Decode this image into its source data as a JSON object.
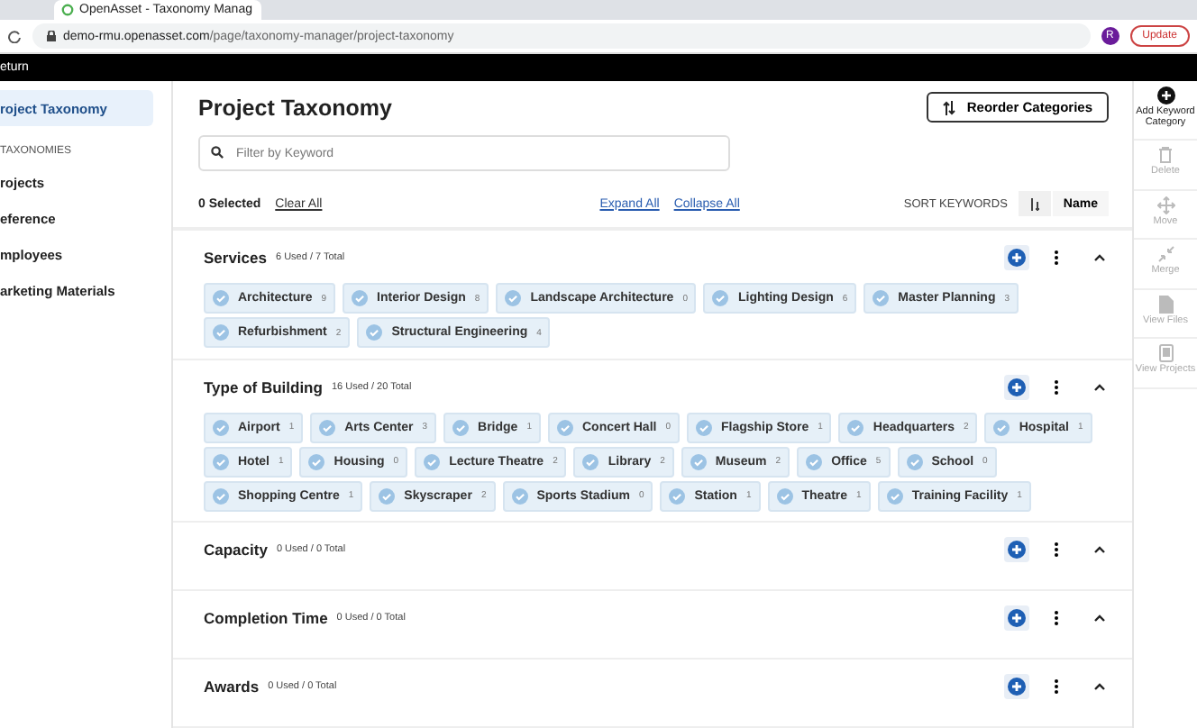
{
  "browser": {
    "tab_title": "OpenAsset - Taxonomy Manag",
    "url_host": "demo-rmu.openasset.com",
    "url_path": "/page/taxonomy-manager/project-taxonomy",
    "avatar": "R",
    "update": "Update"
  },
  "topbar": {
    "label": "eturn"
  },
  "sidebar": {
    "items": [
      {
        "label": "roject Taxonomy",
        "selected": true
      }
    ],
    "section": "TAXONOMIES",
    "links": [
      {
        "label": "rojects",
        "selected": false
      },
      {
        "label": "eference",
        "selected": false
      },
      {
        "label": "mployees",
        "selected": false
      },
      {
        "label": "arketing Materials",
        "selected": false
      }
    ]
  },
  "header": {
    "title": "Project Taxonomy",
    "reorder": "Reorder Categories",
    "search": {
      "placeholder": "Filter by Keyword"
    },
    "selected": "0 Selected",
    "clear": "Clear All",
    "expand": "Expand All",
    "collapse": "Collapse All",
    "sort_label": "SORT KEYWORDS",
    "sort_by": "Name"
  },
  "categories": [
    {
      "name": "Services",
      "summary": "6 Used / 7 Total",
      "expanded": true,
      "keywords": [
        {
          "label": "Architecture",
          "count": "9"
        },
        {
          "label": "Interior Design",
          "count": "8"
        },
        {
          "label": "Landscape Architecture",
          "count": "0"
        },
        {
          "label": "Lighting Design",
          "count": "6"
        },
        {
          "label": "Master Planning",
          "count": "3"
        },
        {
          "label": "Refurbishment",
          "count": "2"
        },
        {
          "label": "Structural Engineering",
          "count": "4"
        }
      ]
    },
    {
      "name": "Type of Building",
      "summary": "16 Used / 20 Total",
      "expanded": true,
      "keywords": [
        {
          "label": "Airport",
          "count": "1"
        },
        {
          "label": "Arts Center",
          "count": "3"
        },
        {
          "label": "Bridge",
          "count": "1"
        },
        {
          "label": "Concert Hall",
          "count": "0"
        },
        {
          "label": "Flagship Store",
          "count": "1"
        },
        {
          "label": "Headquarters",
          "count": "2"
        },
        {
          "label": "Hospital",
          "count": "1"
        },
        {
          "label": "Hotel",
          "count": "1"
        },
        {
          "label": "Housing",
          "count": "0"
        },
        {
          "label": "Lecture Theatre",
          "count": "2"
        },
        {
          "label": "Library",
          "count": "2"
        },
        {
          "label": "Museum",
          "count": "2"
        },
        {
          "label": "Office",
          "count": "5"
        },
        {
          "label": "School",
          "count": "0"
        },
        {
          "label": "Shopping Centre",
          "count": "1"
        },
        {
          "label": "Skyscraper",
          "count": "2"
        },
        {
          "label": "Sports Stadium",
          "count": "0"
        },
        {
          "label": "Station",
          "count": "1"
        },
        {
          "label": "Theatre",
          "count": "1"
        },
        {
          "label": "Training Facility",
          "count": "1"
        }
      ]
    },
    {
      "name": "Capacity",
      "summary": "0 Used / 0 Total",
      "expanded": true
    },
    {
      "name": "Completion Time",
      "summary": "0 Used / 0 Total",
      "expanded": true
    },
    {
      "name": "Awards",
      "summary": "0 Used / 0 Total",
      "expanded": true
    }
  ],
  "rail": [
    {
      "kind": "add",
      "label": "Add Keyword Category",
      "disabled": false
    },
    {
      "kind": "delete",
      "label": "Delete",
      "disabled": true
    },
    {
      "kind": "move",
      "label": "Move",
      "disabled": true
    },
    {
      "kind": "merge",
      "label": "Merge",
      "disabled": true
    },
    {
      "kind": "files",
      "label": "View Files",
      "disabled": true
    },
    {
      "kind": "projects",
      "label": "View Projects",
      "disabled": true
    }
  ]
}
